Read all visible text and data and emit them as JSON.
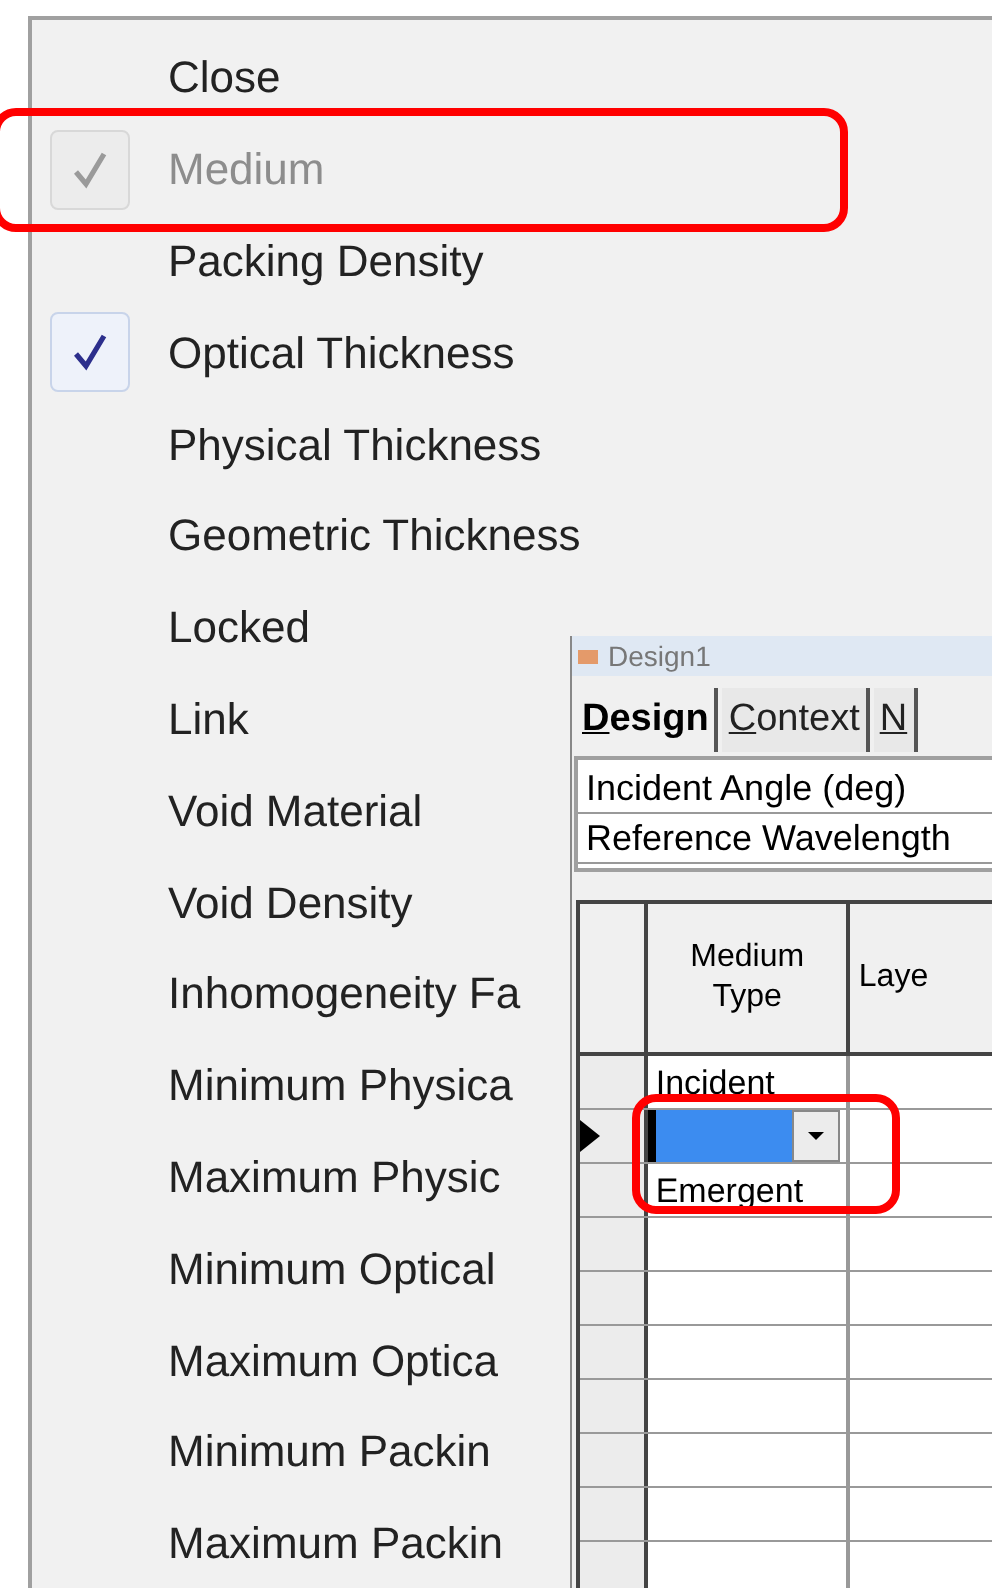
{
  "menu": {
    "items": [
      {
        "label": "Close",
        "checked": false,
        "disabled": false
      },
      {
        "label": "Medium",
        "checked": true,
        "disabled": true,
        "callout": true
      },
      {
        "label": "Packing Density",
        "checked": false,
        "disabled": false
      },
      {
        "label": "Optical Thickness",
        "checked": true,
        "disabled": false
      },
      {
        "label": "Physical Thickness",
        "checked": false,
        "disabled": false
      },
      {
        "label": "Geometric Thickness",
        "checked": false,
        "disabled": false
      },
      {
        "label": "Locked",
        "checked": false,
        "disabled": false
      },
      {
        "label": "Link",
        "checked": false,
        "disabled": false
      },
      {
        "label": "Void Material",
        "checked": false,
        "disabled": false
      },
      {
        "label": "Void Density",
        "checked": false,
        "disabled": false
      },
      {
        "label": "Inhomogeneity Fa",
        "checked": false,
        "disabled": false
      },
      {
        "label": "Minimum Physica",
        "checked": false,
        "disabled": false
      },
      {
        "label": "Maximum Physic",
        "checked": false,
        "disabled": false
      },
      {
        "label": "Minimum Optical",
        "checked": false,
        "disabled": false
      },
      {
        "label": "Maximum Optica",
        "checked": false,
        "disabled": false
      },
      {
        "label": "Minimum Packin",
        "checked": false,
        "disabled": false
      },
      {
        "label": "Maximum Packin",
        "checked": false,
        "disabled": false
      }
    ]
  },
  "window": {
    "title": "Design1",
    "tabs": [
      {
        "label": "Design",
        "selected": true
      },
      {
        "label": "Context",
        "selected": false
      },
      {
        "label": "N",
        "selected": false
      }
    ],
    "properties": [
      "Incident Angle (deg)",
      "Reference Wavelength"
    ],
    "grid": {
      "columns": [
        "Medium Type",
        "Laye"
      ],
      "rows": [
        {
          "kind": "text",
          "current": false,
          "medium": "Incident"
        },
        {
          "kind": "editor",
          "current": true,
          "callout": true
        },
        {
          "kind": "text",
          "current": false,
          "medium": "Emergent"
        },
        {
          "kind": "empty",
          "current": false
        },
        {
          "kind": "empty",
          "current": false
        },
        {
          "kind": "empty",
          "current": false
        },
        {
          "kind": "empty",
          "current": false
        },
        {
          "kind": "empty",
          "current": false
        },
        {
          "kind": "empty",
          "current": false
        },
        {
          "kind": "empty",
          "current": false
        }
      ]
    }
  }
}
